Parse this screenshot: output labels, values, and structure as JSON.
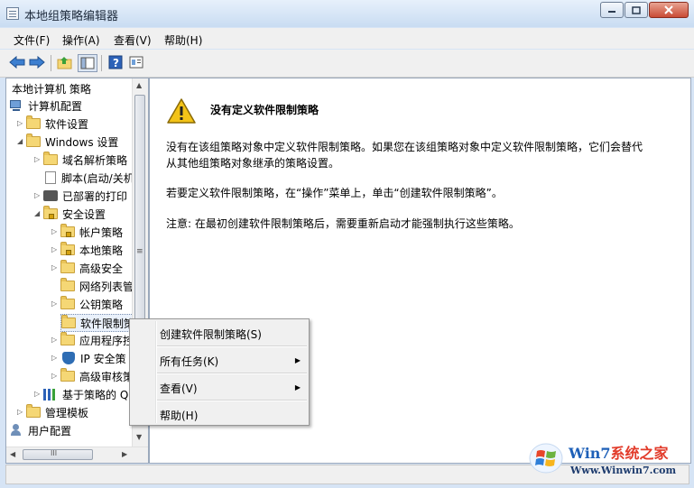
{
  "window": {
    "title": "本地组策略编辑器",
    "min_label": "▭",
    "max_label": "▢",
    "close_label": "✕"
  },
  "menu": [
    "文件(F)",
    "操作(A)",
    "查看(V)",
    "帮助(H)"
  ],
  "toolbar": {
    "buttons": [
      "back-icon",
      "forward-icon",
      "up-folder-icon",
      "show-hide-tree-icon",
      "help-icon",
      "properties-icon"
    ]
  },
  "tree": {
    "items": [
      {
        "label": "本地计算机 策略"
      },
      {
        "label": "计算机配置"
      },
      {
        "label": "软件设置"
      },
      {
        "label": "Windows 设置"
      },
      {
        "label": "域名解析策略"
      },
      {
        "label": "脚本(启动/关机"
      },
      {
        "label": "已部署的打印"
      },
      {
        "label": "安全设置"
      },
      {
        "label": "帐户策略"
      },
      {
        "label": "本地策略"
      },
      {
        "label": "高级安全"
      },
      {
        "label": "网络列表管"
      },
      {
        "label": "公钥策略"
      },
      {
        "label": "软件限制策"
      },
      {
        "label": "应用程序控"
      },
      {
        "label": "IP 安全策"
      },
      {
        "label": "高级审核策"
      },
      {
        "label": "基于策略的 Q"
      },
      {
        "label": "管理模板"
      },
      {
        "label": "用户配置"
      }
    ],
    "scroll_grip": "≡",
    "hscroll_grip": "III"
  },
  "content": {
    "heading": "没有定义软件限制策略",
    "para1_line1": "没有在该组策略对象中定义软件限制策略。如果您在该组策略对象中定义软件限制策略，它们会替代",
    "para1_line2": "从其他组策略对象继承的策略设置。",
    "para2": "若要定义软件限制策略，在“操作”菜单上，单击“创建软件限制策略”。",
    "para3": "注意: 在最初创建软件限制策略后，需要重新启动才能强制执行这些策略。"
  },
  "context_menu": {
    "items": [
      {
        "label": "创建软件限制策略(S)",
        "submenu": false
      },
      {
        "label": "所有任务(K)",
        "submenu": true
      },
      {
        "label": "查看(V)",
        "submenu": true
      },
      {
        "label": "帮助(H)",
        "submenu": false
      }
    ]
  },
  "watermark": {
    "brand_prefix": "Win7",
    "brand_suffix": "系统之家",
    "url": "Www.Winwin7.com"
  }
}
